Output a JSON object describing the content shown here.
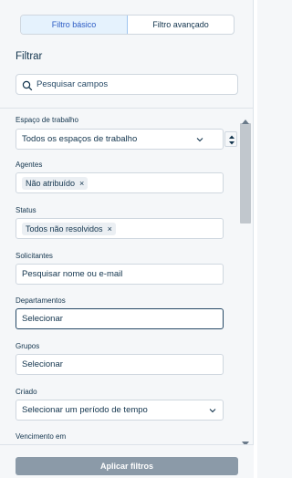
{
  "tabs": {
    "basic": "Filtro básico",
    "advanced": "Filtro avançado"
  },
  "heading": "Filtrar",
  "search": {
    "placeholder": "Pesquisar campos"
  },
  "fields": {
    "workspace": {
      "label": "Espaço de trabalho",
      "value": "Todos os espaços de trabalho"
    },
    "agents": {
      "label": "Agentes",
      "chip": "Não atribuído",
      "chip_remove": "×"
    },
    "status": {
      "label": "Status",
      "chip": "Todos não resolvidos",
      "chip_remove": "×"
    },
    "requesters": {
      "label": "Solicitantes",
      "placeholder": "Pesquisar nome ou e-mail"
    },
    "departments": {
      "label": "Departamentos",
      "placeholder": "Selecionar"
    },
    "groups": {
      "label": "Grupos",
      "placeholder": "Selecionar"
    },
    "created": {
      "label": "Criado",
      "value": "Selecionar um período de tempo"
    },
    "due": {
      "label": "Vencimento em"
    }
  },
  "footer": {
    "apply_label": "Aplicar filtros"
  },
  "colors": {
    "accent": "#2c5cc5",
    "active_tab_bg": "#e5f2fd",
    "apply_bg": "#8b9aa8"
  }
}
